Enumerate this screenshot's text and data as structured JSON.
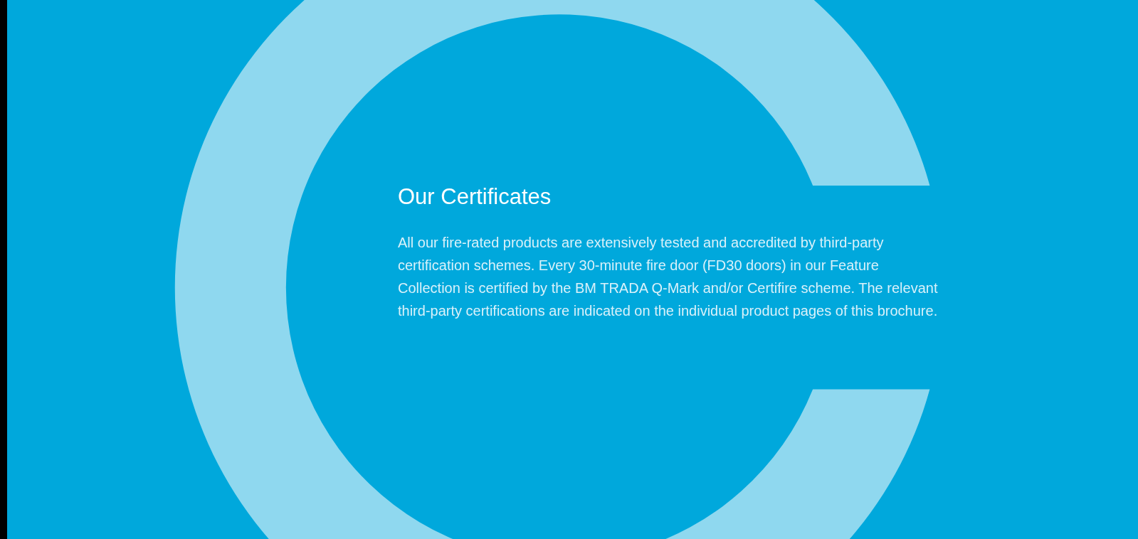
{
  "heading": "Our Certificates",
  "body": "All our fire-rated products are extensively tested and accredited by third-party certification schemes. Every 30-minute fire door (FD30 doors) in our Feature Collection is certified by the BM TRADA Q-Mark and/or Certifire scheme. The relevant third-party certifications are indicated on the individual product pages of this brochure."
}
